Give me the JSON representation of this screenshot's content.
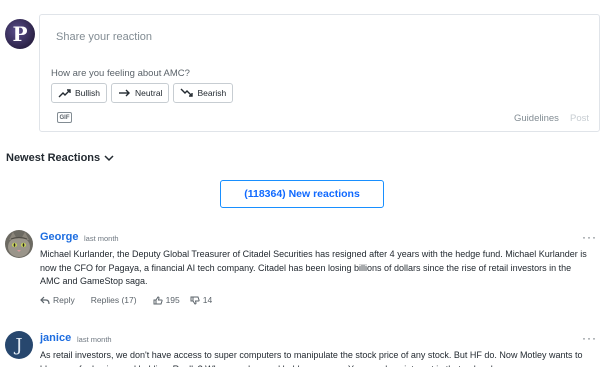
{
  "composer": {
    "avatar_letter": "P",
    "placeholder": "Share your reaction",
    "question": "How are you feeling about AMC?",
    "sentiments": [
      {
        "label": "Bullish",
        "icon": "trend-up-icon"
      },
      {
        "label": "Neutral",
        "icon": "arrow-right-icon"
      },
      {
        "label": "Bearish",
        "icon": "trend-down-icon"
      }
    ],
    "gif_label": "GIF",
    "guidelines_label": "Guidelines",
    "post_label": "Post"
  },
  "sort": {
    "label": "Newest Reactions"
  },
  "new_reactions": {
    "label": "(118364) New reactions"
  },
  "reactions": [
    {
      "name": "George",
      "time": "last month",
      "body": "Michael Kurlander, the Deputy Global Treasurer of Citadel Securities has resigned after 4 years with the hedge fund. Michael Kurlander is now the CFO for Pagaya, a financial AI tech company. Citadel has been losing billions of dollars since the rise of retail investors in the AMC and GameStop saga.",
      "reply_label": "Reply",
      "replies_label": "Replies (17)",
      "upvotes": "195",
      "downvotes": "14"
    },
    {
      "name": "janice",
      "avatar_letter": "J",
      "time": "last month",
      "body": "As retail investors, we don't have access to super computers to manipulate the stock price of any stock. But HF do. Now Motley wants to blame us for buying and holding. Really? When you buy and hold some own. You may lose interest in that, rules do your own"
    }
  ],
  "colors": {
    "accent": "#188fff",
    "link": "#1d6de0",
    "text": "#232a31",
    "muted": "#828c93"
  }
}
